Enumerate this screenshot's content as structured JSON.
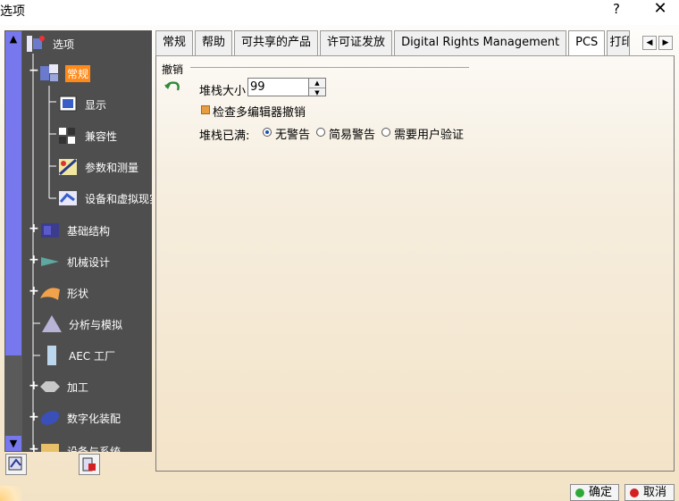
{
  "window": {
    "title": "选项",
    "help_label": "?",
    "close_label": "✕"
  },
  "tree": {
    "root_label": "选项",
    "items": [
      {
        "label": "常规",
        "selected": true
      },
      {
        "label": "显示"
      },
      {
        "label": "兼容性"
      },
      {
        "label": "参数和测量"
      },
      {
        "label": "设备和虚拟现实"
      },
      {
        "label": "基础结构"
      },
      {
        "label": "机械设计"
      },
      {
        "label": "形状"
      },
      {
        "label": "分析与模拟"
      },
      {
        "label": "AEC 工厂"
      },
      {
        "label": "加工"
      },
      {
        "label": "数字化装配"
      },
      {
        "label": "设备与系统"
      }
    ],
    "scroll_up": "▲",
    "scroll_down": "▼"
  },
  "tabs": [
    {
      "label": "常规"
    },
    {
      "label": "帮助"
    },
    {
      "label": "可共享的产品"
    },
    {
      "label": "许可证发放"
    },
    {
      "label": "Digital Rights Management"
    },
    {
      "label": "PCS",
      "active": true
    },
    {
      "label": "打印"
    }
  ],
  "tab_nav": {
    "prev": "◀",
    "next": "▶"
  },
  "undo": {
    "group_title": "撤销",
    "stack_size_label": "堆栈大小",
    "stack_size_value": "99",
    "multi_editor_label": "检查多编辑器撤销",
    "multi_editor_checked": true,
    "stack_full_label": "堆栈已满:",
    "options": [
      {
        "label": "无警告",
        "selected": true
      },
      {
        "label": "简易警告"
      },
      {
        "label": "需要用户验证"
      }
    ]
  },
  "buttons": {
    "ok_label": "确定",
    "cancel_label": "取消"
  },
  "colors": {
    "tree_bg": "#4e4e4e",
    "selected_bg": "#ff8a1a",
    "scroll_thumb": "#7777ee",
    "ok_dot": "#2fa83a",
    "cancel_dot": "#d42020"
  }
}
